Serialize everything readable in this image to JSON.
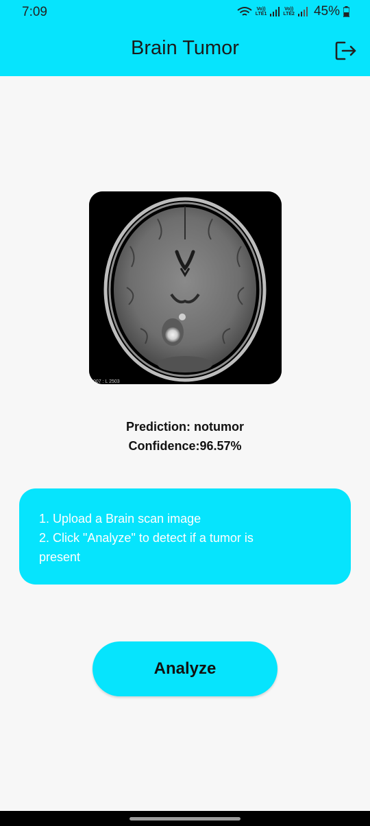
{
  "status_bar": {
    "time": "7:09",
    "sim1": {
      "top": "Vo))",
      "bottom": "LTE1"
    },
    "sim2": {
      "top": "Vo))",
      "bottom": "LTE2"
    },
    "battery": "45%"
  },
  "app_bar": {
    "title": "Brain Tumor",
    "logout_icon": "logout-icon"
  },
  "scan": {
    "label": "007 : L 2503"
  },
  "result": {
    "prediction": "Prediction: notumor",
    "confidence": "Confidence:96.57%"
  },
  "instructions": {
    "line1": "1. Upload a Brain scan image",
    "line2": "2. Click \"Analyze\" to detect if a tumor is",
    "line3": "present"
  },
  "actions": {
    "analyze_label": "Analyze"
  },
  "colors": {
    "accent": "#06e4fd",
    "background": "#f7f7f7"
  }
}
